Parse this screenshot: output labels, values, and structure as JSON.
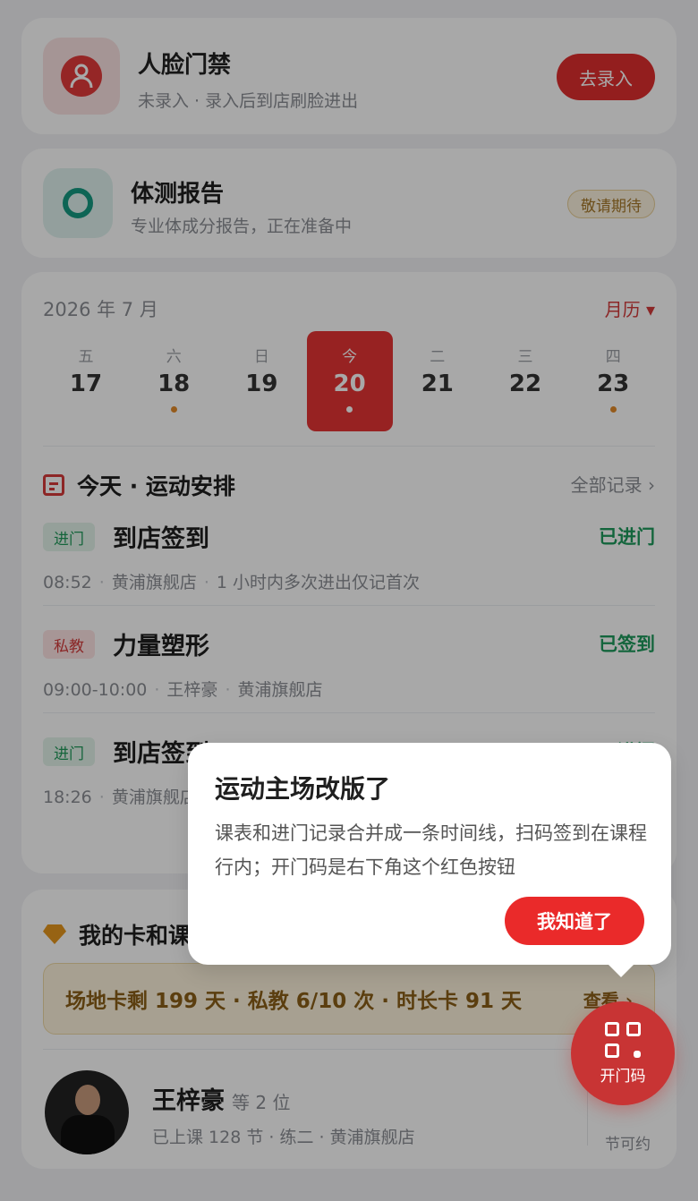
{
  "face": {
    "title": "人脸门禁",
    "subtitle": "未录入 · 录入后到店刷脸进出",
    "button": "去录入"
  },
  "bodytest": {
    "title": "体测报告",
    "subtitle": "专业体成分报告，正在准备中",
    "badge": "敬请期待"
  },
  "calendar": {
    "month": "2026 年 7 月",
    "link": "月历 ▾",
    "days": [
      {
        "wk": "五",
        "d": "17",
        "dot": false
      },
      {
        "wk": "六",
        "d": "18",
        "dot": true
      },
      {
        "wk": "日",
        "d": "19",
        "dot": false
      },
      {
        "wk": "今",
        "d": "20",
        "dot": true,
        "selected": true
      },
      {
        "wk": "二",
        "d": "21",
        "dot": false
      },
      {
        "wk": "三",
        "d": "22",
        "dot": false
      },
      {
        "wk": "四",
        "d": "23",
        "dot": true
      }
    ],
    "dot_color": "#e38b2a"
  },
  "schedule": {
    "title": "今天 · 运动安排",
    "all": "全部记录 ›",
    "events": [
      {
        "tag": "进门",
        "tone": "g",
        "name": "到店签到",
        "status": "已进门",
        "time": "08:52",
        "store": "黄浦旗舰店",
        "note": "1 小时内多次进出仅记首次"
      },
      {
        "tag": "私教",
        "tone": "r",
        "name": "力量塑形",
        "status": "已签到",
        "time": "09:00-10:00",
        "coach": "王梓豪",
        "store": "黄浦旗舰店"
      },
      {
        "tag": "进门",
        "tone": "g",
        "name": "到店签到",
        "status": "已进门",
        "time": "18:26",
        "store": "黄浦旗舰店"
      }
    ]
  },
  "mycards": {
    "title": "我的卡和课",
    "summary": "场地卡剩 199 天 · 私教 6/10 次 · 时长卡 91 天",
    "link": "查看 ›",
    "coach": "王梓豪",
    "coach_more": "等 2 位",
    "coach_meta": "已上课 128 节 · 练二 · 黄浦旗舰店",
    "available_label": "节可约"
  },
  "popup": {
    "title": "运动主场改版了",
    "body": "课表和进门记录合并成一条时间线，扫码签到在课程行内；开门码是右下角这个红色按钮",
    "button": "我知道了"
  },
  "fab": {
    "label": "开门码"
  }
}
